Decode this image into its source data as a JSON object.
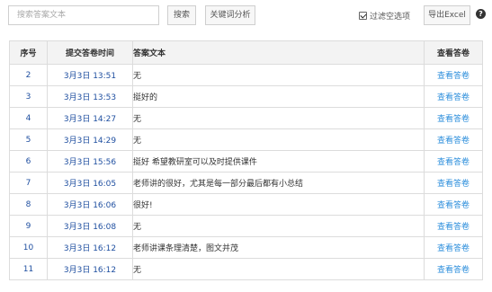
{
  "toolbar": {
    "search_placeholder": "搜索答案文本",
    "search_button": "搜索",
    "keyword_button": "关键词分析",
    "filter_label": "过滤空选项",
    "export_button": "导出Excel",
    "help_icon_text": "?"
  },
  "table": {
    "headers": [
      "序号",
      "提交答卷时间",
      "答案文本",
      "查看答卷"
    ],
    "rows": [
      {
        "seq": "2",
        "time": "3月3日 13:51",
        "text": "无",
        "view": "查看答卷"
      },
      {
        "seq": "3",
        "time": "3月3日 13:53",
        "text": "挺好的",
        "view": "查看答卷"
      },
      {
        "seq": "4",
        "time": "3月3日 14:27",
        "text": "无",
        "view": "查看答卷"
      },
      {
        "seq": "5",
        "time": "3月3日 14:29",
        "text": "无",
        "view": "查看答卷"
      },
      {
        "seq": "6",
        "time": "3月3日 15:56",
        "text": "挺好 希望教研室可以及时提供课件",
        "view": "查看答卷"
      },
      {
        "seq": "7",
        "time": "3月3日 16:05",
        "text": "老师讲的很好，尤其是每一部分最后都有小总结",
        "view": "查看答卷"
      },
      {
        "seq": "8",
        "time": "3月3日 16:06",
        "text": "很好!",
        "view": "查看答卷"
      },
      {
        "seq": "9",
        "time": "3月3日 16:08",
        "text": "无",
        "view": "查看答卷"
      },
      {
        "seq": "10",
        "time": "3月3日 16:12",
        "text": "老师讲课条理清楚，图文并茂",
        "view": "查看答卷"
      },
      {
        "seq": "11",
        "time": "3月3日 16:12",
        "text": "无",
        "view": "查看答卷"
      }
    ]
  },
  "colors": {
    "link": "#2e8fdc",
    "index_text": "#1f4fa0",
    "header_bg": "#f3f3f3",
    "border": "#dcdcdc"
  }
}
